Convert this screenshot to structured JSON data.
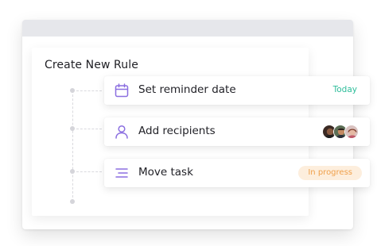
{
  "panel": {
    "title": "Create New Rule"
  },
  "steps": [
    {
      "label": "Set reminder date",
      "icon": "calendar-icon",
      "meta": "Today"
    },
    {
      "label": "Add recipients",
      "icon": "user-icon",
      "avatars": [
        "recipient-avatar-1",
        "recipient-avatar-2",
        "recipient-avatar-3"
      ]
    },
    {
      "label": "Move task",
      "icon": "list-lines-icon",
      "status": "In progress"
    }
  ],
  "colors": {
    "accent_icon": "#8b6fe0",
    "today": "#2dbd9a",
    "status_text": "#f0a04b",
    "status_bg": "#fdeedd",
    "window_bar": "#e6e7eb"
  }
}
